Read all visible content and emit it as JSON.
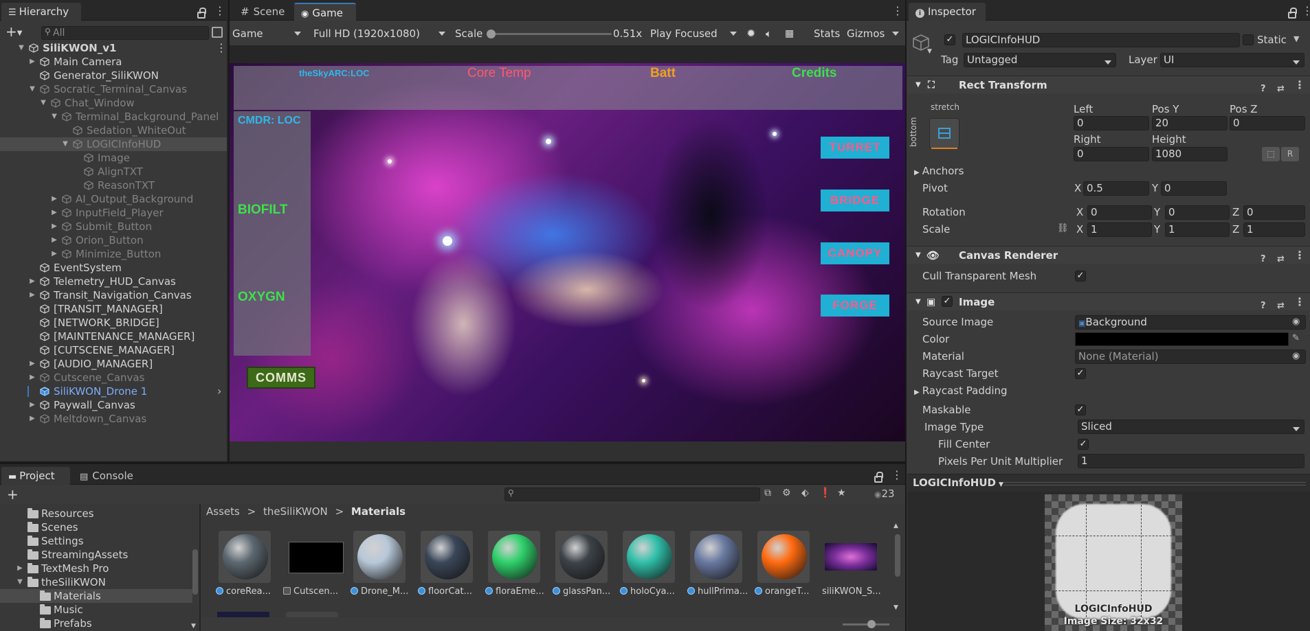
{
  "hierarchy": {
    "tab_label": "Hierarchy",
    "search_placeholder": "All",
    "items": [
      {
        "label": "SiliKWON_v1",
        "depth": 0,
        "expanded": true,
        "scene": true
      },
      {
        "label": "Main Camera",
        "depth": 1,
        "arrow": true
      },
      {
        "label": "Generator_SiliKWON",
        "depth": 1
      },
      {
        "label": "Socratic_Terminal_Canvas",
        "depth": 1,
        "expanded": true,
        "dim": true
      },
      {
        "label": "Chat_Window",
        "depth": 2,
        "expanded": true,
        "dim": true
      },
      {
        "label": "Terminal_Background_Panel",
        "depth": 3,
        "expanded": true,
        "dim": true
      },
      {
        "label": "Sedation_WhiteOut",
        "depth": 4,
        "dim": true
      },
      {
        "label": "LOGICInfoHUD",
        "depth": 4,
        "expanded": true,
        "selected": true,
        "dim": true
      },
      {
        "label": "Image",
        "depth": 5,
        "dim": true
      },
      {
        "label": "AlignTXT",
        "depth": 5,
        "dim": true
      },
      {
        "label": "ReasonTXT",
        "depth": 5,
        "dim": true
      },
      {
        "label": "AI_Output_Background",
        "depth": 3,
        "arrow": true,
        "dim": true
      },
      {
        "label": "InputField_Player",
        "depth": 3,
        "arrow": true,
        "dim": true
      },
      {
        "label": "Submit_Button",
        "depth": 3,
        "arrow": true,
        "dim": true
      },
      {
        "label": "Orion_Button",
        "depth": 3,
        "arrow": true,
        "dim": true
      },
      {
        "label": "Minimize_Button",
        "depth": 3,
        "arrow": true,
        "dim": true
      },
      {
        "label": "EventSystem",
        "depth": 1
      },
      {
        "label": "Telemetry_HUD_Canvas",
        "depth": 1,
        "arrow": true
      },
      {
        "label": "Transit_Navigation_Canvas",
        "depth": 1,
        "arrow": true
      },
      {
        "label": "[TRANSIT_MANAGER]",
        "depth": 1
      },
      {
        "label": "[NETWORK_BRIDGE]",
        "depth": 1
      },
      {
        "label": "[MAINTENANCE_MANAGER]",
        "depth": 1
      },
      {
        "label": "[CUTSCENE_MANAGER]",
        "depth": 1
      },
      {
        "label": "[AUDIO_MANAGER]",
        "depth": 1,
        "arrow": true
      },
      {
        "label": "Cutscene_Canvas",
        "depth": 1,
        "arrow": true,
        "dim": true
      },
      {
        "label": "SiliKWON_Drone 1",
        "depth": 1,
        "prefab": true
      },
      {
        "label": "Paywall_Canvas",
        "depth": 1,
        "arrow": true
      },
      {
        "label": "Meltdown_Canvas",
        "depth": 1,
        "arrow": true,
        "dim": true
      }
    ]
  },
  "center_tabs": {
    "scene": "Scene",
    "game": "Game"
  },
  "game_toolbar": {
    "display": "Game",
    "resolution": "Full HD (1920x1080)",
    "scale_label": "Scale",
    "scale_value": "0.51x",
    "scale_fraction": 0.0,
    "play_mode": "Play Focused",
    "stats": "Stats",
    "gizmos": "Gizmos"
  },
  "game_view": {
    "top_labels": {
      "sky": "theSkyARC:LOC",
      "core": "Core Temp",
      "batt": "Batt",
      "credits": "Credits"
    },
    "left_labels": {
      "cmdr": "CMDR: LOC",
      "biofilt": "BIOFILT",
      "oxygn": "OXYGN"
    },
    "right_buttons": [
      "TURRET",
      "BRIDGE",
      "CANOPY",
      "FORGE"
    ],
    "comms": "COMMS",
    "colors": {
      "sky": "#2fb8e8",
      "core": "#ff5a6e",
      "batt": "#f0a020",
      "credits": "#3ee04a",
      "cmdr": "#2fb8e8",
      "green": "#3ee04a",
      "btn_bg": "#1fb0d4",
      "btn_text": "#ff5a87"
    }
  },
  "inspector": {
    "tab_label": "Inspector",
    "object_name": "LOGICInfoHUD",
    "static_label": "Static",
    "tag_label": "Tag",
    "tag_value": "Untagged",
    "layer_label": "Layer",
    "layer_value": "UI",
    "rect_transform": {
      "title": "Rect Transform",
      "anchor_preset_top": "stretch",
      "anchor_preset_side": "bottom",
      "left_label": "Left",
      "left": "0",
      "posy_label": "Pos Y",
      "posy": "20",
      "posz_label": "Pos Z",
      "posz": "0",
      "right_label": "Right",
      "right": "0",
      "height_label": "Height",
      "height": "1080",
      "anchors_label": "Anchors",
      "pivot_label": "Pivot",
      "pivot_x": "0.5",
      "pivot_y": "0",
      "rotation_label": "Rotation",
      "rot_x": "0",
      "rot_y": "0",
      "rot_z": "0",
      "scale_label": "Scale",
      "scale_x": "1",
      "scale_y": "1",
      "scale_z": "1",
      "axis_x": "X",
      "axis_y": "Y",
      "axis_z": "Z"
    },
    "canvas_renderer": {
      "title": "Canvas Renderer",
      "cull_label": "Cull Transparent Mesh"
    },
    "image": {
      "title": "Image",
      "source_label": "Source Image",
      "source_value": "Background",
      "color_label": "Color",
      "material_label": "Material",
      "material_value": "None (Material)",
      "raycast_label": "Raycast Target",
      "raycast_padding_label": "Raycast Padding",
      "maskable_label": "Maskable",
      "image_type_label": "Image Type",
      "image_type_value": "Sliced",
      "fill_center_label": "Fill Center",
      "ppu_label": "Pixels Per Unit Multiplier",
      "ppu_value": "1"
    },
    "preview": {
      "title": "LOGICInfoHUD",
      "name": "LOGICInfoHUD",
      "size": "Image Size: 32x32"
    }
  },
  "project": {
    "tab_project": "Project",
    "tab_console": "Console",
    "count": "23",
    "breadcrumb": [
      "Assets",
      "theSiliKWON",
      "Materials"
    ],
    "folders": [
      {
        "label": "Resources",
        "depth": 1
      },
      {
        "label": "Scenes",
        "depth": 1
      },
      {
        "label": "Settings",
        "depth": 1
      },
      {
        "label": "StreamingAssets",
        "depth": 1
      },
      {
        "label": "TextMesh Pro",
        "depth": 1,
        "arrow": true
      },
      {
        "label": "theSiliKWON",
        "depth": 1,
        "expanded": true
      },
      {
        "label": "Materials",
        "depth": 2,
        "selected": true
      },
      {
        "label": "Music",
        "depth": 2
      },
      {
        "label": "Prefabs",
        "depth": 2
      }
    ],
    "assets": [
      {
        "label": "coreRea...",
        "kind": "material",
        "color": "#5c6770"
      },
      {
        "label": "Cutscen...",
        "kind": "other",
        "color": "#000000"
      },
      {
        "label": "Drone_M...",
        "kind": "material",
        "color": "#b8c8d8"
      },
      {
        "label": "floorCat...",
        "kind": "material",
        "color": "#3a4658"
      },
      {
        "label": "floraEme...",
        "kind": "material",
        "color": "#2ed06a"
      },
      {
        "label": "glassPan...",
        "kind": "material",
        "color": "#3c4248"
      },
      {
        "label": "holoCya...",
        "kind": "material",
        "color": "#2fbfa8"
      },
      {
        "label": "hullPrima...",
        "kind": "material",
        "color": "#6878a0"
      },
      {
        "label": "orangeT...",
        "kind": "material",
        "color": "#ff6a10"
      },
      {
        "label": "siliKWON_S...",
        "kind": "texture",
        "color": "#7a2f9a"
      }
    ]
  }
}
